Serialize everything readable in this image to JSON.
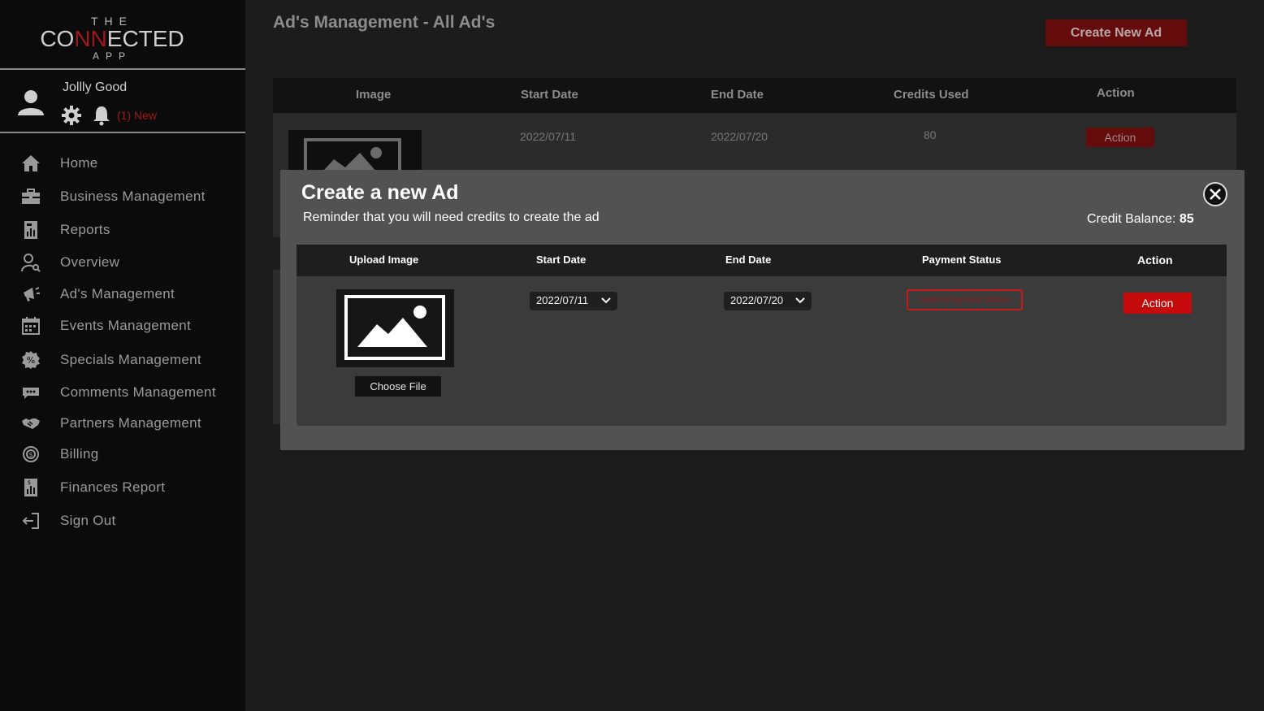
{
  "logo": {
    "the": "THE",
    "main_left": "CO",
    "main_x": "NN",
    "main_right": "ECTED",
    "app": "APP"
  },
  "user": {
    "name": "Jollly Good",
    "notifications": "(1) New"
  },
  "nav": [
    {
      "label": "Home",
      "icon": "home-icon"
    },
    {
      "label": "Business Management",
      "icon": "briefcase-icon"
    },
    {
      "label": "Reports",
      "icon": "report-icon"
    },
    {
      "label": "Overview",
      "icon": "user-search-icon"
    },
    {
      "label": "Ad's Management",
      "icon": "megaphone-icon"
    },
    {
      "label": "Events Management",
      "icon": "calendar-icon"
    },
    {
      "label": "Specials Management",
      "icon": "discount-badge-icon"
    },
    {
      "label": "Comments Management",
      "icon": "comments-icon"
    },
    {
      "label": "Partners Management",
      "icon": "handshake-icon"
    },
    {
      "label": "Billing",
      "icon": "billing-icon"
    },
    {
      "label": "Finances Report",
      "icon": "finance-report-icon"
    },
    {
      "label": "Sign Out",
      "icon": "sign-out-icon"
    }
  ],
  "page": {
    "title": "Ad's Management - All Ad's",
    "create_button": "Create New Ad"
  },
  "bg_table": {
    "headers": [
      "Image",
      "Start Date",
      "End Date",
      "Credits Used",
      "Action"
    ],
    "row": {
      "start": "2022/07/11",
      "end": "2022/07/20",
      "credits": "80",
      "action": "Action"
    }
  },
  "modal": {
    "title": "Create a new Ad",
    "subtitle": "Reminder that you will need credits to create the ad",
    "credit_label": "Credit Balance:",
    "credit_value": "85",
    "headers": [
      "Upload Image",
      "Start Date",
      "End Date",
      "Payment Status",
      "Action"
    ],
    "choose_file": "Choose File",
    "start_date": "2022/07/11",
    "end_date": "2022/07/20",
    "payment_placeholder": "Select Payment Status",
    "action": "Action"
  },
  "colors": {
    "accent": "#c40a0a",
    "accent_dark": "#640c0c",
    "sidebar": "#0b0b0b",
    "modal": "#525252"
  }
}
